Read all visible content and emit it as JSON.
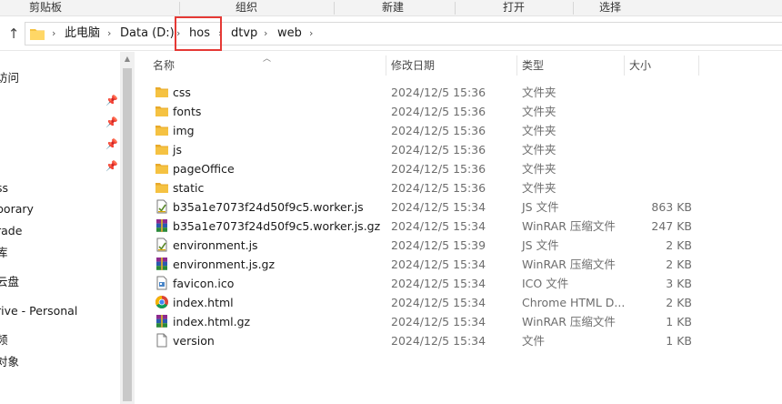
{
  "ribbon": {
    "groups": [
      "剪贴板",
      "组织",
      "新建",
      "打开",
      "选择"
    ]
  },
  "address": {
    "crumbs": [
      "此电脑",
      "Data (D:)",
      "hos",
      "dtvp",
      "web"
    ]
  },
  "navpane": {
    "items": [
      "访问",
      "ss",
      "porary",
      "rade",
      "库",
      "云盘",
      "rive - Personal",
      "频",
      "对象"
    ]
  },
  "columns": {
    "name": "名称",
    "modified": "修改日期",
    "type": "类型",
    "size": "大小"
  },
  "files": [
    {
      "name": "css",
      "date": "2024/12/5 15:36",
      "type": "文件夹",
      "size": "",
      "icon": "folder-icon"
    },
    {
      "name": "fonts",
      "date": "2024/12/5 15:36",
      "type": "文件夹",
      "size": "",
      "icon": "folder-icon"
    },
    {
      "name": "img",
      "date": "2024/12/5 15:36",
      "type": "文件夹",
      "size": "",
      "icon": "folder-icon"
    },
    {
      "name": "js",
      "date": "2024/12/5 15:36",
      "type": "文件夹",
      "size": "",
      "icon": "folder-icon"
    },
    {
      "name": "pageOffice",
      "date": "2024/12/5 15:36",
      "type": "文件夹",
      "size": "",
      "icon": "folder-icon"
    },
    {
      "name": "static",
      "date": "2024/12/5 15:36",
      "type": "文件夹",
      "size": "",
      "icon": "folder-icon"
    },
    {
      "name": "b35a1e7073f24d50f9c5.worker.js",
      "date": "2024/12/5 15:34",
      "type": "JS 文件",
      "size": "863 KB",
      "icon": "js-file-icon"
    },
    {
      "name": "b35a1e7073f24d50f9c5.worker.js.gz",
      "date": "2024/12/5 15:34",
      "type": "WinRAR 压缩文件",
      "size": "247 KB",
      "icon": "winrar-archive-icon"
    },
    {
      "name": "environment.js",
      "date": "2024/12/5 15:39",
      "type": "JS 文件",
      "size": "2 KB",
      "icon": "js-file-icon"
    },
    {
      "name": "environment.js.gz",
      "date": "2024/12/5 15:34",
      "type": "WinRAR 压缩文件",
      "size": "2 KB",
      "icon": "winrar-archive-icon"
    },
    {
      "name": "favicon.ico",
      "date": "2024/12/5 15:34",
      "type": "ICO 文件",
      "size": "3 KB",
      "icon": "ico-file-icon"
    },
    {
      "name": "index.html",
      "date": "2024/12/5 15:34",
      "type": "Chrome HTML D...",
      "size": "2 KB",
      "icon": "chrome-html-icon"
    },
    {
      "name": "index.html.gz",
      "date": "2024/12/5 15:34",
      "type": "WinRAR 压缩文件",
      "size": "1 KB",
      "icon": "winrar-archive-icon"
    },
    {
      "name": "version",
      "date": "2024/12/5 15:34",
      "type": "文件",
      "size": "1 KB",
      "icon": "blank-file-icon"
    }
  ],
  "colors": {
    "folder": "#f5c242",
    "highlight": "#e53935",
    "chrome_red": "#db4437",
    "chrome_yellow": "#f4b400",
    "chrome_green": "#0f9d58",
    "chrome_blue": "#4285f4"
  }
}
